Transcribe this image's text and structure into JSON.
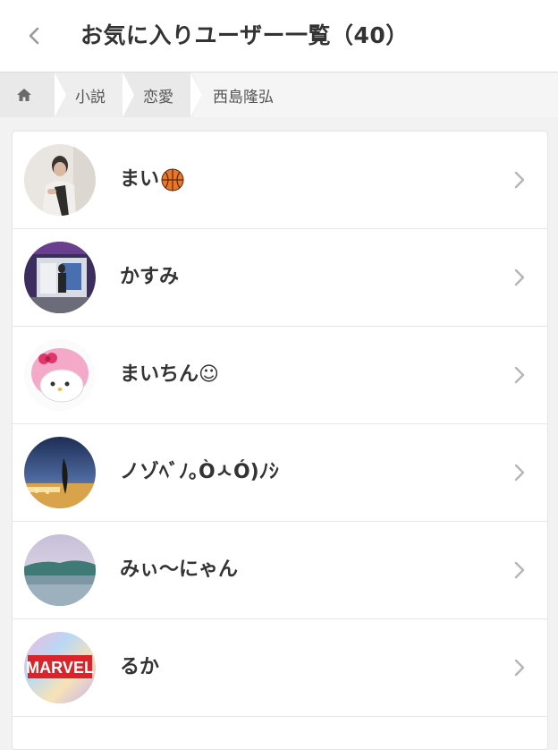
{
  "header": {
    "back_icon": "chevron-left-icon",
    "title": "お気に入りユーザー一覧（40）"
  },
  "breadcrumb": {
    "home_icon": "home-icon",
    "items": [
      "小説",
      "恋愛",
      "西島隆弘"
    ]
  },
  "users": [
    {
      "name": "まい",
      "avatar": "photo-person-posing",
      "emoji": "basketball-icon"
    },
    {
      "name": "かすみ",
      "avatar": "photo-person-at-entrance"
    },
    {
      "name": "まいちん☺︎",
      "avatar": "my-melody-character"
    },
    {
      "name": "ノゾﾍﾞﾉ｡ÒㅅÓ)ﾉｼ",
      "avatar": "photo-night-beach"
    },
    {
      "name": "みぃ〜にゃん",
      "avatar": "photo-lake-landscape"
    },
    {
      "name": "るか",
      "avatar": "marvel-logo",
      "avatar_text": "MARVEL"
    }
  ],
  "colors": {
    "chevron": "#b5b5b5",
    "text": "#333333",
    "background": "#f2f2f2"
  }
}
